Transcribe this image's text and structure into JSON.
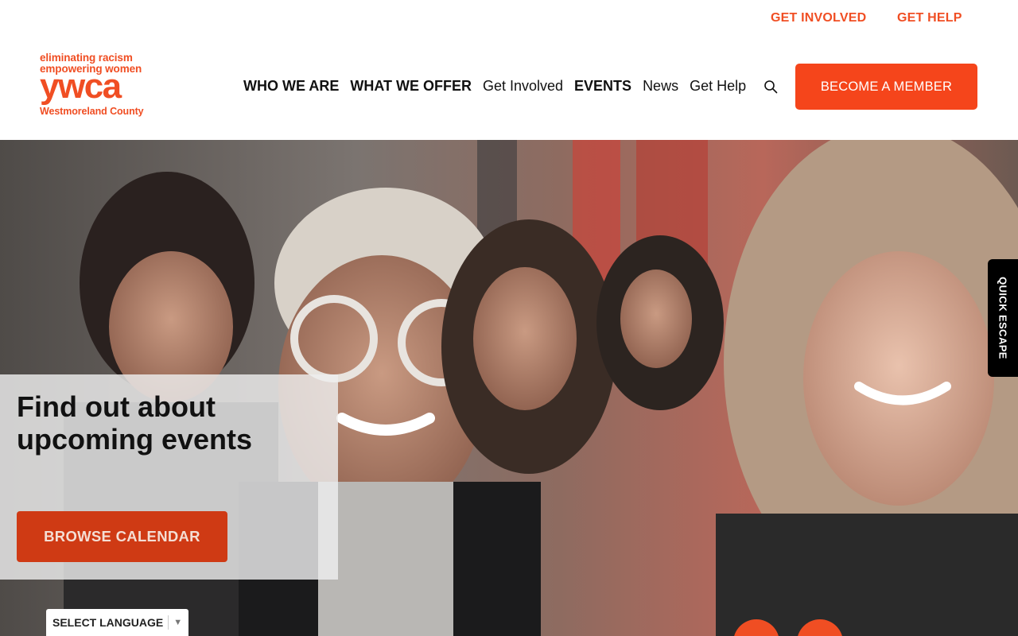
{
  "utility_nav": {
    "get_involved": "GET INVOLVED",
    "get_help": "GET HELP"
  },
  "logo": {
    "tagline_1": "eliminating racism",
    "tagline_2": "empowering women",
    "brand": "ywca",
    "location": "Westmoreland County"
  },
  "main_nav": {
    "items": [
      {
        "label": "WHO WE ARE"
      },
      {
        "label": "WHAT WE OFFER"
      },
      {
        "label": "Get Involved"
      },
      {
        "label": "EVENTS"
      },
      {
        "label": "News"
      },
      {
        "label": "Get Help"
      }
    ],
    "search_icon": "search-icon",
    "cta": "BECOME A MEMBER"
  },
  "hero": {
    "heading": "Find out about upcoming events",
    "button": "BROWSE CALENDAR"
  },
  "language_selector": {
    "label": "SELECT LANGUAGE",
    "arrow": "▼"
  },
  "quick_escape": "QUICK ESCAPE",
  "colors": {
    "accent": "#f04e23",
    "button": "#f5451b",
    "hero_button": "#cf3a14"
  }
}
